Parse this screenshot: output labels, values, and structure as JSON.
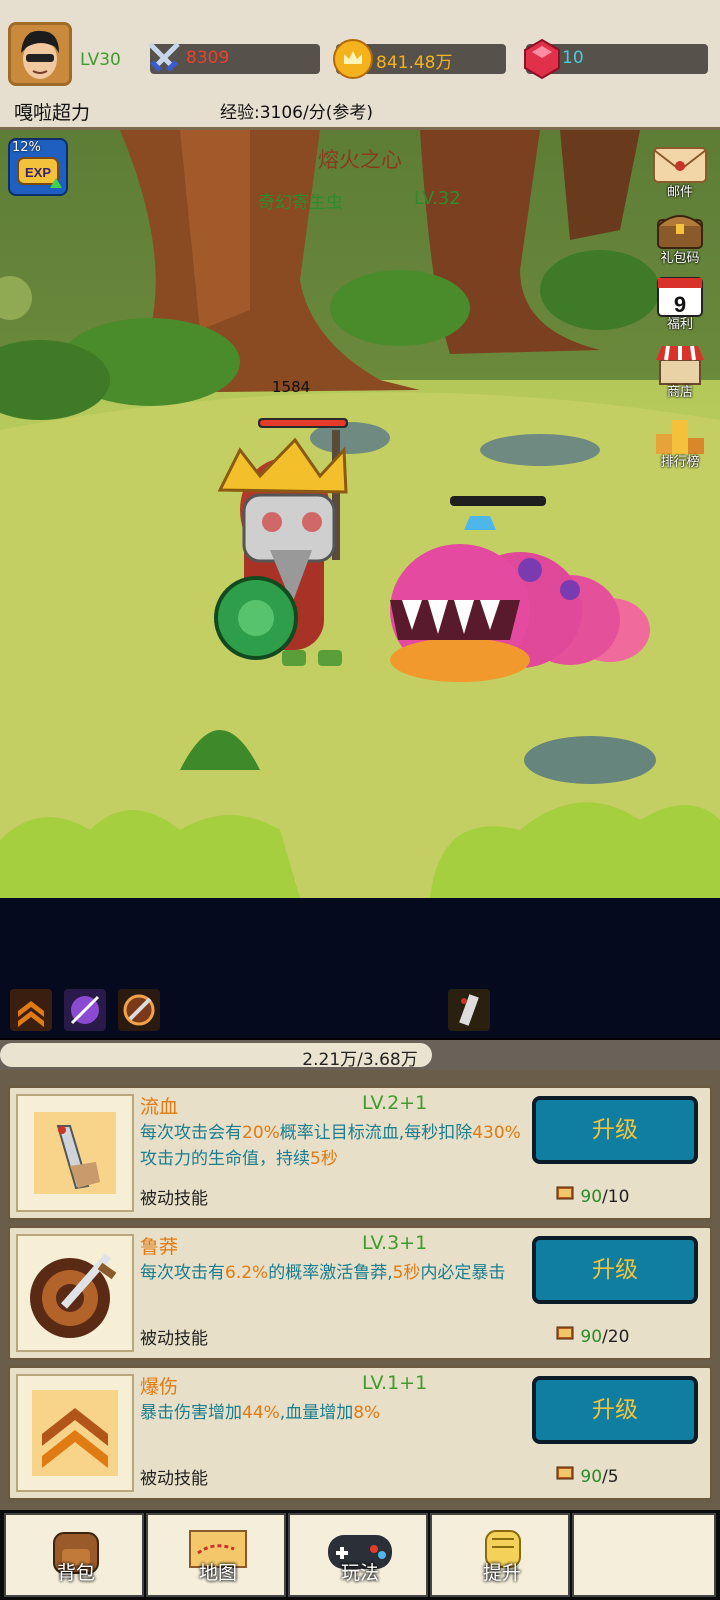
{
  "player": {
    "name": "嘎啦超力",
    "level": "LV30"
  },
  "stats": {
    "attack": "8309",
    "gold": "841.48万",
    "gems": "10"
  },
  "exp_rate": "经验:3106/分(参考)",
  "exp_boost": "12%",
  "stage": {
    "name": "熔火之心",
    "enemy_name": "奇幻寄生虫",
    "enemy_level": "LV.32",
    "hero_hp": "1584"
  },
  "side_menu": [
    "邮件",
    "礼包码",
    "福利",
    "商店",
    "排行榜"
  ],
  "calendar_day": "9",
  "progress": {
    "text": "2.21万/3.68万",
    "fraction": 0.6
  },
  "skills": [
    {
      "name": "流血",
      "level": "LV.2+1",
      "desc_parts": [
        "每次攻击会有",
        "20%",
        "概率让目标流血,每秒扣除",
        "430%",
        "攻击力的生命值，持续",
        "5秒"
      ],
      "type": "被动技能",
      "button": "升级",
      "have": "90",
      "need": "/10"
    },
    {
      "name": "鲁莽",
      "level": "LV.3+1",
      "desc_parts": [
        "每次攻击有",
        "6.2%",
        "的概率激活鲁莽,",
        "5秒",
        "内必定暴击"
      ],
      "type": "被动技能",
      "button": "升级",
      "have": "90",
      "need": "/20"
    },
    {
      "name": "爆伤",
      "level": "LV.1+1",
      "desc_parts": [
        "暴击伤害增加",
        "44%",
        ",血量增加",
        "8%"
      ],
      "type": "被动技能",
      "button": "升级",
      "have": "90",
      "need": "/5"
    }
  ],
  "nav": [
    "背包",
    "地图",
    "玩法",
    "提升"
  ],
  "colors": {
    "accent_orange": "#e07a12",
    "highlight_yellow": "#f3c33b",
    "button_teal": "#0f7ea1",
    "green_text": "#3f9b2d"
  }
}
